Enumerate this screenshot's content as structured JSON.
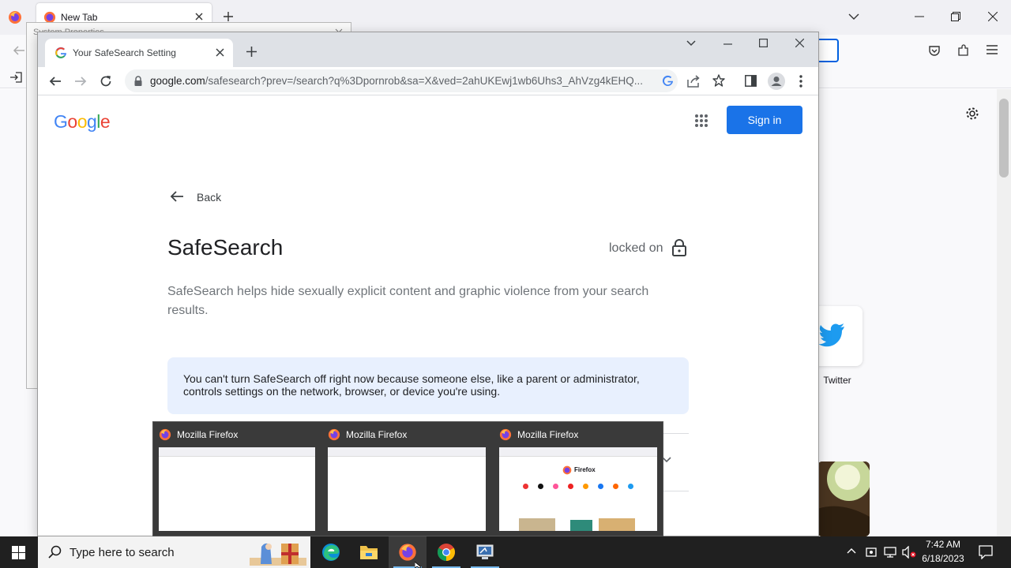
{
  "firefox": {
    "tab_title": "New Tab",
    "dialog_title": "System Properties",
    "twitter_label": "Twitter"
  },
  "chrome": {
    "tab_title": "Your SafeSearch Setting",
    "url_host": "google.com",
    "url_path": "/safesearch?prev=/search?q%3Dpornrob&sa=X&ved=2ahUKEwj1wb6Uhs3_AhVzg4kEHQ..."
  },
  "page": {
    "logo": "Google",
    "sign_in": "Sign in",
    "back": "Back",
    "title": "SafeSearch",
    "status": "locked on",
    "description": "SafeSearch helps hide sexually explicit content and graphic violence from your search results.",
    "notice": "You can't turn SafeSearch off right now because someone else, like a parent or administrator, controls settings on the network, browser, or device you're using."
  },
  "preview": {
    "windows": [
      {
        "title": "Mozilla Firefox"
      },
      {
        "title": "Mozilla Firefox"
      },
      {
        "title": "Mozilla Firefox",
        "content_label": "Firefox"
      }
    ]
  },
  "taskbar": {
    "search_placeholder": "Type here to search",
    "time": "7:42 AM",
    "date": "6/18/2023"
  },
  "colors": {
    "google_blue": "#4285f4",
    "google_red": "#ea4335",
    "google_yellow": "#fbbc05",
    "google_green": "#34a853",
    "signin_blue": "#1a73e8",
    "taskbar": "#202020"
  },
  "icons": [
    "firefox-icon",
    "chrome-icon",
    "edge-icon",
    "file-explorer-icon",
    "google-apps-icon",
    "lock-icon",
    "back-arrow-icon",
    "twitter-icon",
    "windows-start-icon",
    "search-icon",
    "settings-gear-icon",
    "notification-icon"
  ]
}
